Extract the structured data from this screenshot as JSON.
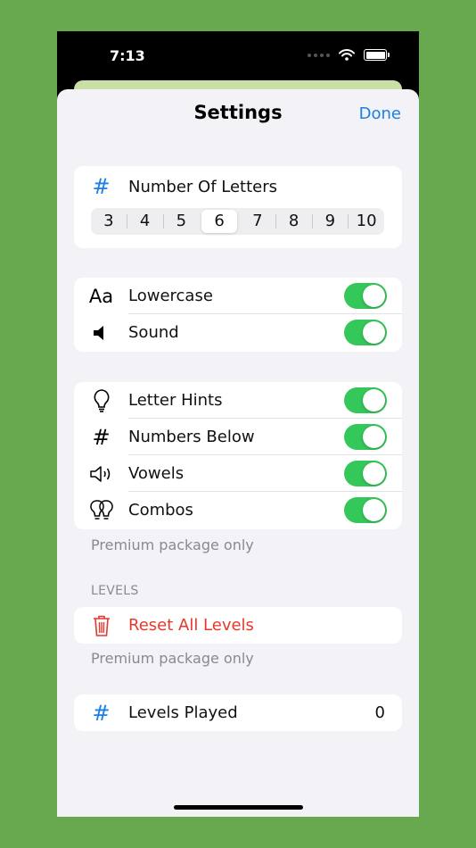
{
  "status": {
    "time": "7:13"
  },
  "nav": {
    "title": "Settings",
    "done": "Done"
  },
  "letters": {
    "label": "Number Of Letters",
    "options": [
      "3",
      "4",
      "5",
      "6",
      "7",
      "8",
      "9",
      "10"
    ],
    "selected": "6"
  },
  "group1": [
    {
      "label": "Lowercase",
      "icon": "Aa",
      "on": true
    },
    {
      "label": "Sound",
      "icon": "speaker-icon",
      "on": true
    }
  ],
  "group2": [
    {
      "label": "Letter Hints",
      "icon": "lightbulb-icon",
      "on": true
    },
    {
      "label": "Numbers Below",
      "icon": "hash-icon",
      "on": true
    },
    {
      "label": "Vowels",
      "icon": "speaker-wave-icon",
      "on": true
    },
    {
      "label": "Combos",
      "icon": "double-lightbulb-icon",
      "on": true
    }
  ],
  "premium_note": "Premium package only",
  "levels": {
    "header": "LEVELS",
    "reset_label": "Reset All Levels",
    "note": "Premium package only"
  },
  "played": {
    "label": "Levels Played",
    "value": "0"
  },
  "colors": {
    "accent": "#1a7fe6",
    "toggle": "#34c759",
    "destructive": "#e8372c",
    "background": "#68a84f"
  }
}
